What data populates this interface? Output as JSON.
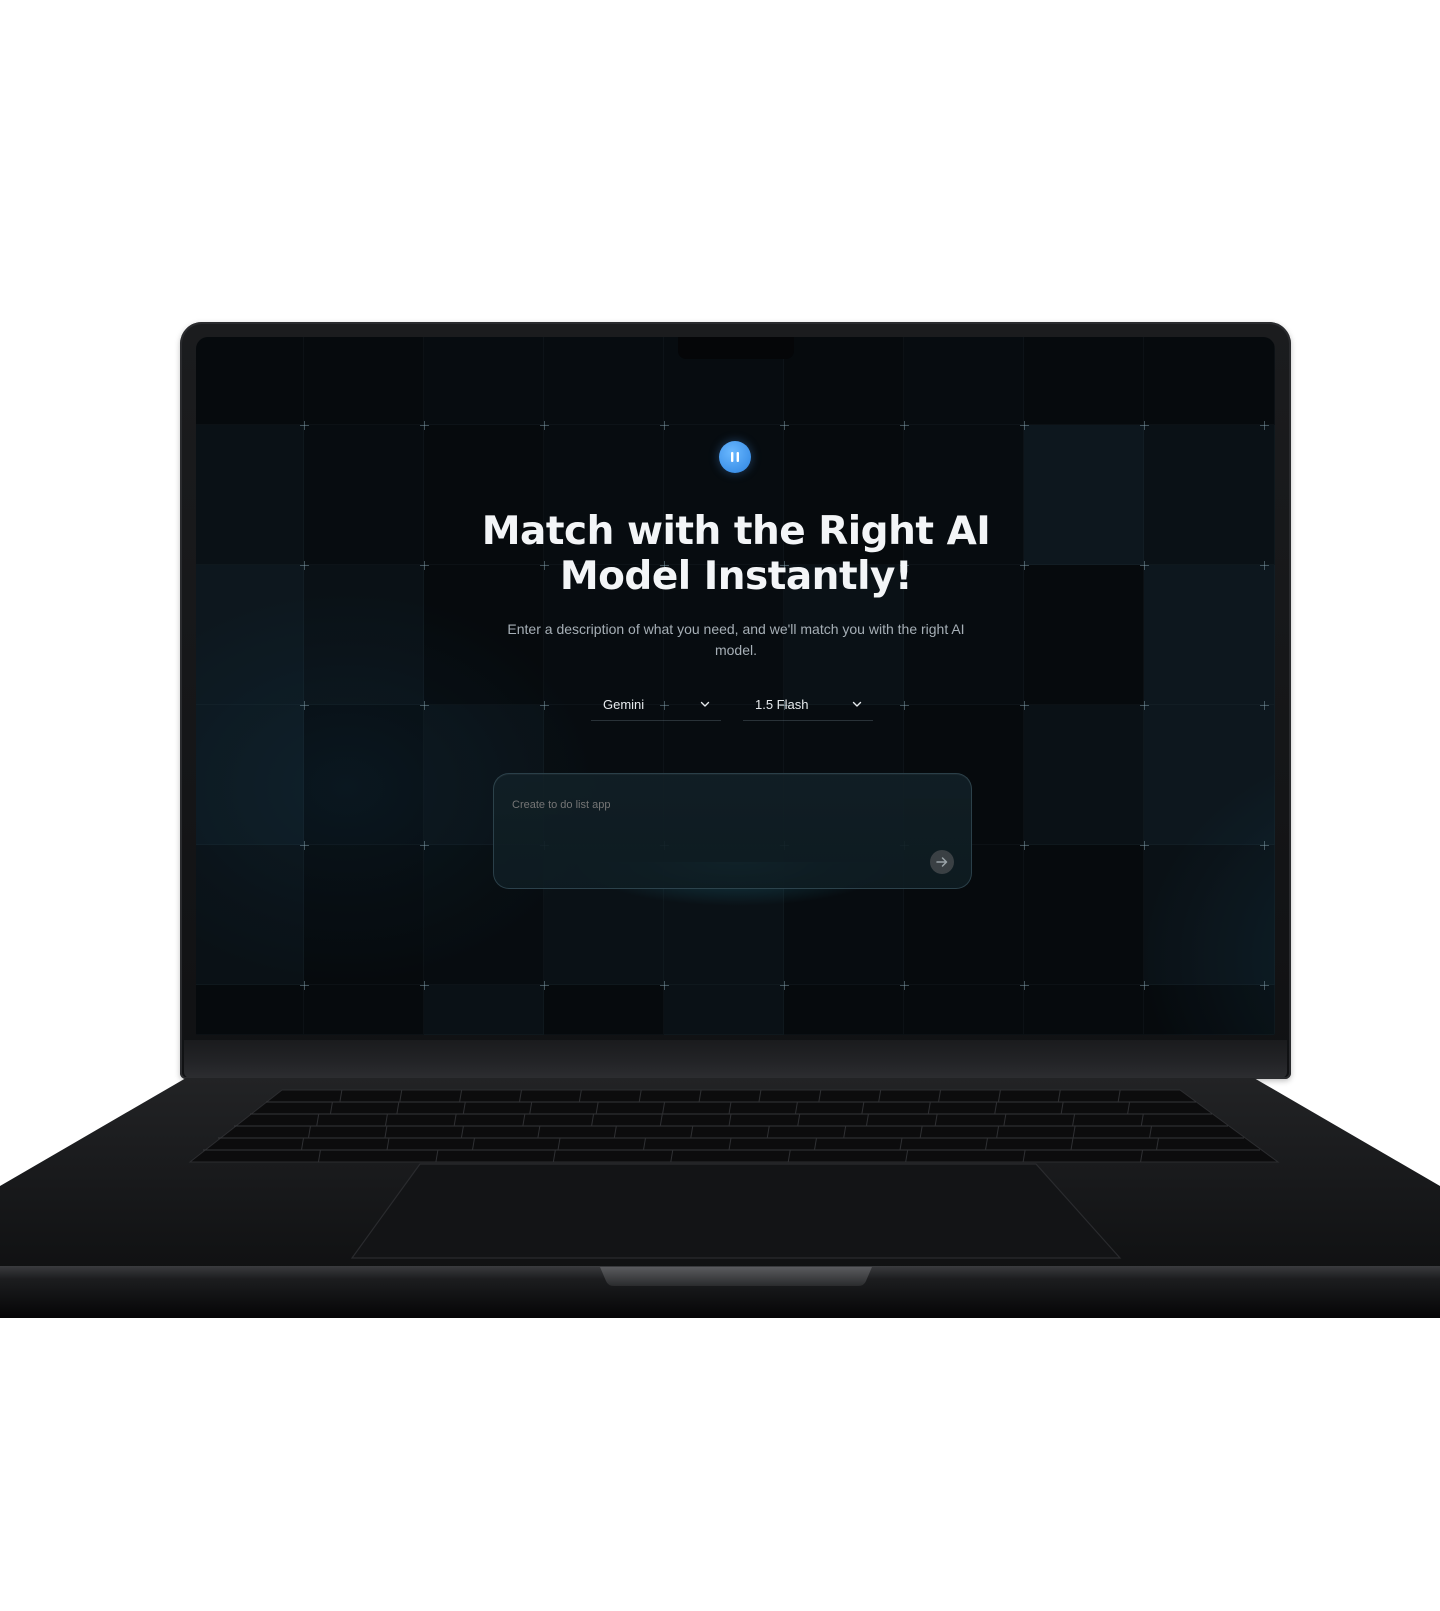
{
  "app": {
    "logo_icon": "pause-icon",
    "headline": "Match with the Right AI Model Instantly!",
    "subtitle": "Enter a description of what you need, and we'll match you with the right AI model.",
    "provider_select": {
      "value": "Gemini",
      "icon": "chevron-down-icon"
    },
    "model_select": {
      "value": "1.5 Flash",
      "icon": "chevron-down-icon"
    },
    "prompt": {
      "value": "",
      "placeholder": "Create to do list app",
      "send_icon": "arrow-right-icon"
    }
  },
  "colors": {
    "screen_bg": "#080d11",
    "accent": "#3f93ea",
    "glow": "#3cbed2",
    "text": "#f3f5f7"
  }
}
